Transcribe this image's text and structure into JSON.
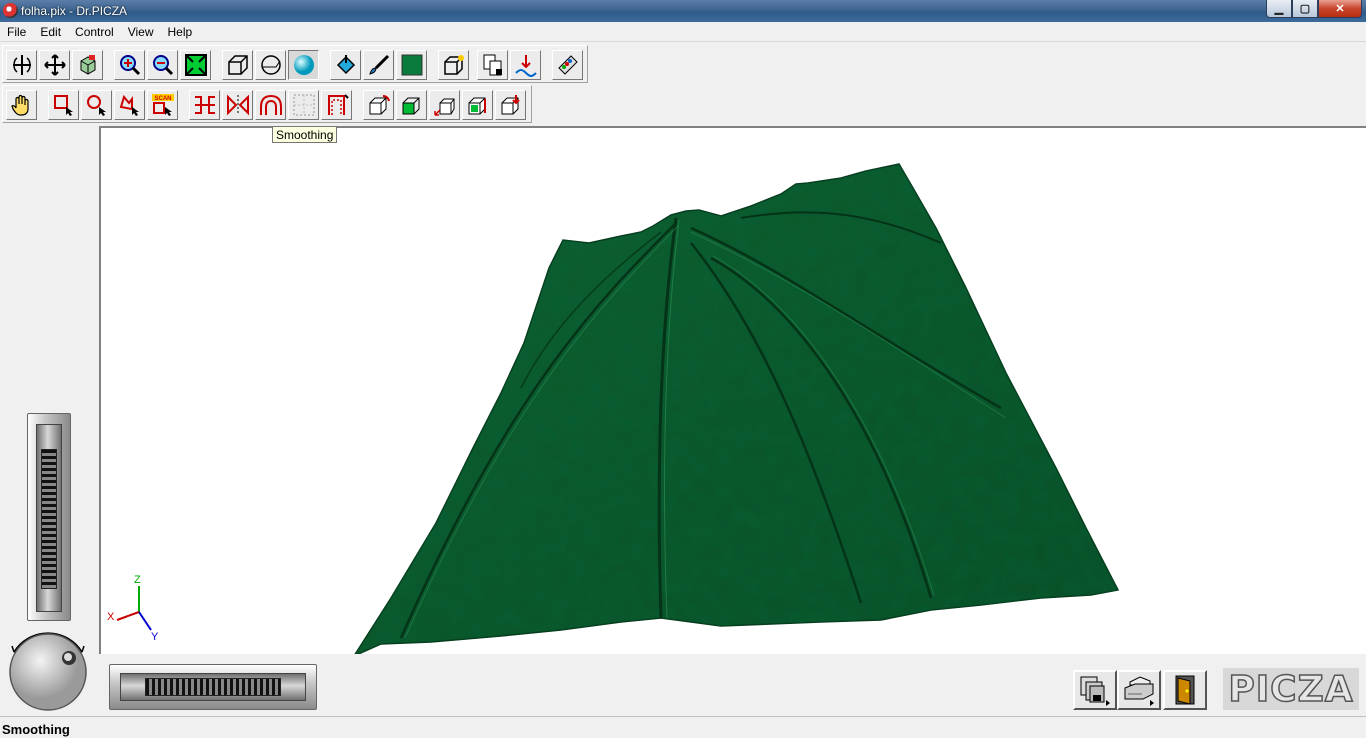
{
  "window": {
    "title": "folha.pix - Dr.PICZA",
    "minimize": "▁",
    "maximize": "▢",
    "close": "✕"
  },
  "menu": [
    {
      "label": "File"
    },
    {
      "label": "Edit"
    },
    {
      "label": "Control"
    },
    {
      "label": "View"
    },
    {
      "label": "Help"
    }
  ],
  "toolbar1": [
    {
      "icon": "rotate-icon"
    },
    {
      "icon": "move-icon"
    },
    {
      "icon": "cube-icon"
    },
    {
      "icon": "zoom-in-icon"
    },
    {
      "icon": "zoom-out-icon"
    },
    {
      "icon": "fit-view-icon"
    },
    {
      "icon": "wireframe-icon"
    },
    {
      "icon": "mesh-sphere-icon"
    },
    {
      "icon": "shaded-sphere-icon"
    },
    {
      "icon": "paint-bucket-icon"
    },
    {
      "icon": "brush-icon"
    },
    {
      "icon": "color-swatch-icon"
    },
    {
      "icon": "box-select-icon"
    },
    {
      "icon": "copy-icon"
    },
    {
      "icon": "scan-icon"
    },
    {
      "icon": "palette-icon"
    }
  ],
  "toolbar2": [
    {
      "icon": "hand-icon"
    },
    {
      "icon": "rect-select-icon"
    },
    {
      "icon": "circle-select-icon"
    },
    {
      "icon": "lasso-select-icon"
    },
    {
      "icon": "scan-area-icon"
    },
    {
      "icon": "cut-icon"
    },
    {
      "icon": "mirror-icon"
    },
    {
      "icon": "smoothing-icon"
    },
    {
      "icon": "grid-icon"
    },
    {
      "icon": "crop-icon"
    },
    {
      "icon": "box-rotate-icon"
    },
    {
      "icon": "box-fill-icon"
    },
    {
      "icon": "box-scale-icon"
    },
    {
      "icon": "box-split-icon"
    },
    {
      "icon": "box-export-icon"
    }
  ],
  "tooltip": "Smoothing",
  "axes": {
    "x": "X",
    "y": "Y",
    "z": "Z"
  },
  "colors": {
    "surface": "#0d5a2e",
    "surface_dark": "#063a1c",
    "accent_red": "#cc0000"
  },
  "scan_label": "SCAN",
  "bottom_buttons": [
    {
      "icon": "save-icon"
    },
    {
      "icon": "print-icon"
    },
    {
      "icon": "exit-door-icon"
    }
  ],
  "logo": "PICZA",
  "status": "Smoothing"
}
